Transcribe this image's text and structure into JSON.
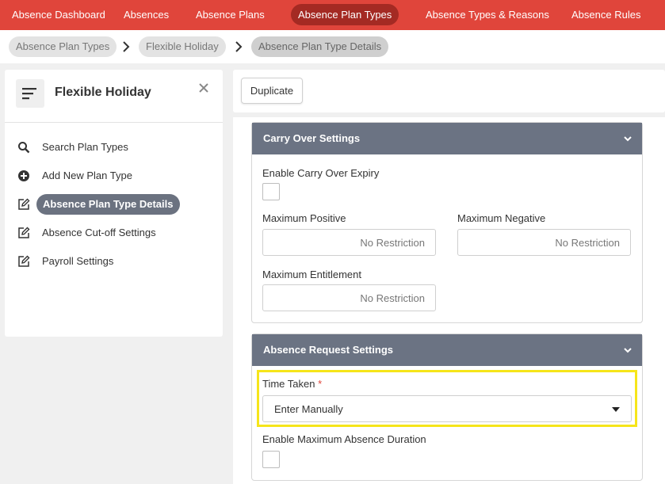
{
  "topnav": {
    "items": [
      {
        "label": "Absence Dashboard"
      },
      {
        "label": "Absences"
      },
      {
        "label": "Absence Plans"
      },
      {
        "label": "Absence Plan Types"
      },
      {
        "label": "Absence Types & Reasons"
      },
      {
        "label": "Absence Rules"
      }
    ],
    "active_index": 3,
    "color": "#e0453b"
  },
  "breadcrumb": [
    {
      "label": "Absence Plan Types"
    },
    {
      "label": "Flexible Holiday"
    },
    {
      "label": "Absence Plan Type Details"
    }
  ],
  "sidebar": {
    "title": "Flexible Holiday",
    "items": [
      {
        "label": "Search Plan Types",
        "icon": "search-icon"
      },
      {
        "label": "Add New Plan Type",
        "icon": "plus-circle-icon"
      },
      {
        "label": "Absence Plan Type Details",
        "icon": "edit-icon",
        "active": true
      },
      {
        "label": "Absence Cut-off Settings",
        "icon": "edit-icon"
      },
      {
        "label": "Payroll Settings",
        "icon": "edit-icon"
      }
    ]
  },
  "toolbar": {
    "duplicate_label": "Duplicate"
  },
  "carry_over": {
    "header": "Carry Over Settings",
    "enable_expiry_label": "Enable Carry Over Expiry",
    "max_positive_label": "Maximum Positive",
    "max_positive_placeholder": "No Restriction",
    "max_negative_label": "Maximum Negative",
    "max_negative_placeholder": "No Restriction",
    "max_entitlement_label": "Maximum Entitlement",
    "max_entitlement_placeholder": "No Restriction"
  },
  "absence_request": {
    "header": "Absence Request Settings",
    "time_taken_label": "Time Taken",
    "required_mark": "*",
    "time_taken_value": "Enter Manually",
    "enable_max_duration_label": "Enable Maximum Absence Duration"
  },
  "colors": {
    "accent": "#e0453b",
    "section_header": "#6b7383",
    "highlight": "#f6e51a"
  }
}
